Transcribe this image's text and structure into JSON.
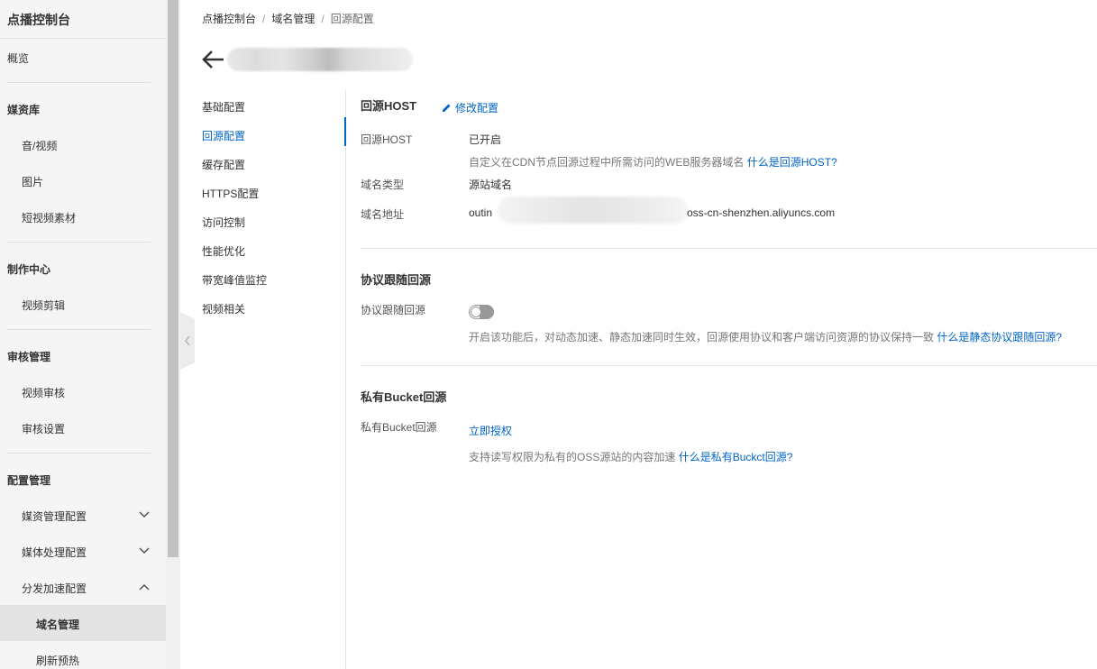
{
  "sidebar": {
    "title": "点播控制台",
    "overview": "概览",
    "groups": [
      {
        "label": "媒资库",
        "items": [
          "音/视频",
          "图片",
          "短视频素材"
        ]
      },
      {
        "label": "制作中心",
        "items": [
          "视频剪辑"
        ]
      },
      {
        "label": "审核管理",
        "items": [
          "视频审核",
          "审核设置"
        ]
      },
      {
        "label": "配置管理",
        "items": [
          "媒资管理配置",
          "媒体处理配置",
          "分发加速配置"
        ]
      }
    ],
    "active_item": "域名管理",
    "next_item": "刷新预热"
  },
  "breadcrumb": [
    "点播控制台",
    "域名管理",
    "回源配置"
  ],
  "subnav": [
    "基础配置",
    "回源配置",
    "缓存配置",
    "HTTPS配置",
    "访问控制",
    "性能优化",
    "带宽峰值监控",
    "视频相关"
  ],
  "subnav_active_index": 1,
  "host_section": {
    "title": "回源HOST",
    "edit_label": "修改配置",
    "host_label": "回源HOST",
    "host_value": "已开启",
    "host_hint": "自定义在CDN节点回源过程中所需访问的WEB服务器域名",
    "host_hint_link": "什么是回源HOST?",
    "domain_type_label": "域名类型",
    "domain_type_value": "源站域名",
    "domain_address_label": "域名地址",
    "domain_address_prefix": "outin",
    "domain_address_suffix": "oss-cn-shenzhen.aliyuncs.com"
  },
  "protocol_section": {
    "title": "协议跟随回源",
    "label": "协议跟随回源",
    "toggle_on": false,
    "hint": "开启该功能后，对动态加速、静态加速同时生效，回源使用协议和客户端访问资源的协议保持一致",
    "hint_link": "什么是静态协议跟随回源?"
  },
  "bucket_section": {
    "title": "私有Bucket回源",
    "label": "私有Bucket回源",
    "action": "立即授权",
    "hint": "支持读写权限为私有的OSS源站的内容加速",
    "hint_link": "什么是私有Buckct回源?"
  },
  "colors": {
    "accent": "#0064c8",
    "sidebar_bg": "#f5f5f5",
    "active_bg": "#e4e4e4"
  }
}
